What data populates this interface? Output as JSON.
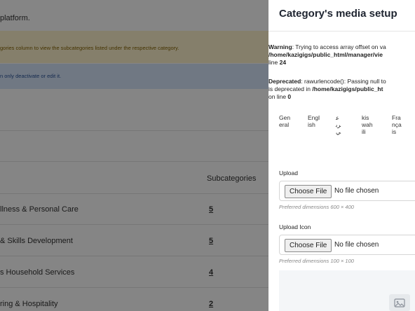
{
  "background": {
    "intro_text": "platform.",
    "alert_warning": "gories column to view the subcategories listed under the respective category.",
    "alert_info": "n only deactivate or edit it.",
    "table": {
      "header_subcategories": "Subcategories",
      "rows": [
        {
          "category": "llness & Personal Care",
          "count": "5"
        },
        {
          "category": "& Skills Development",
          "count": "5"
        },
        {
          "category": "s Household Services",
          "count": "4"
        },
        {
          "category": "ring & Hospitality",
          "count": "2"
        }
      ]
    }
  },
  "panel": {
    "title": "Category's media setup",
    "warning": {
      "label": "Warning",
      "line1_rest": ": Trying to access array offset on va",
      "line2": "/home/kazigigs/public_html/manager/vie",
      "line3_prefix": "line ",
      "line3_num": "24"
    },
    "deprecated": {
      "label": "Deprecated",
      "line1_rest": ": rawurlencode(): Passing null to",
      "line2_prefix": "is deprecated in ",
      "line2_path": "/home/kazigigs/public_ht",
      "line3_prefix": "on line ",
      "line3_num": "0"
    },
    "language_tabs": [
      "General",
      "English",
      "عربي",
      "kiswahili",
      "Français"
    ],
    "upload": {
      "label": "Upload",
      "button": "Choose File",
      "status": "No file chosen",
      "hint": "Preferred dimensions 600 × 400"
    },
    "upload_icon": {
      "label": "Upload Icon",
      "button": "Choose File",
      "status": "No file chosen",
      "hint": "Preferred dimensions 100 × 100"
    },
    "preview_icon": "image-placeholder-icon"
  }
}
